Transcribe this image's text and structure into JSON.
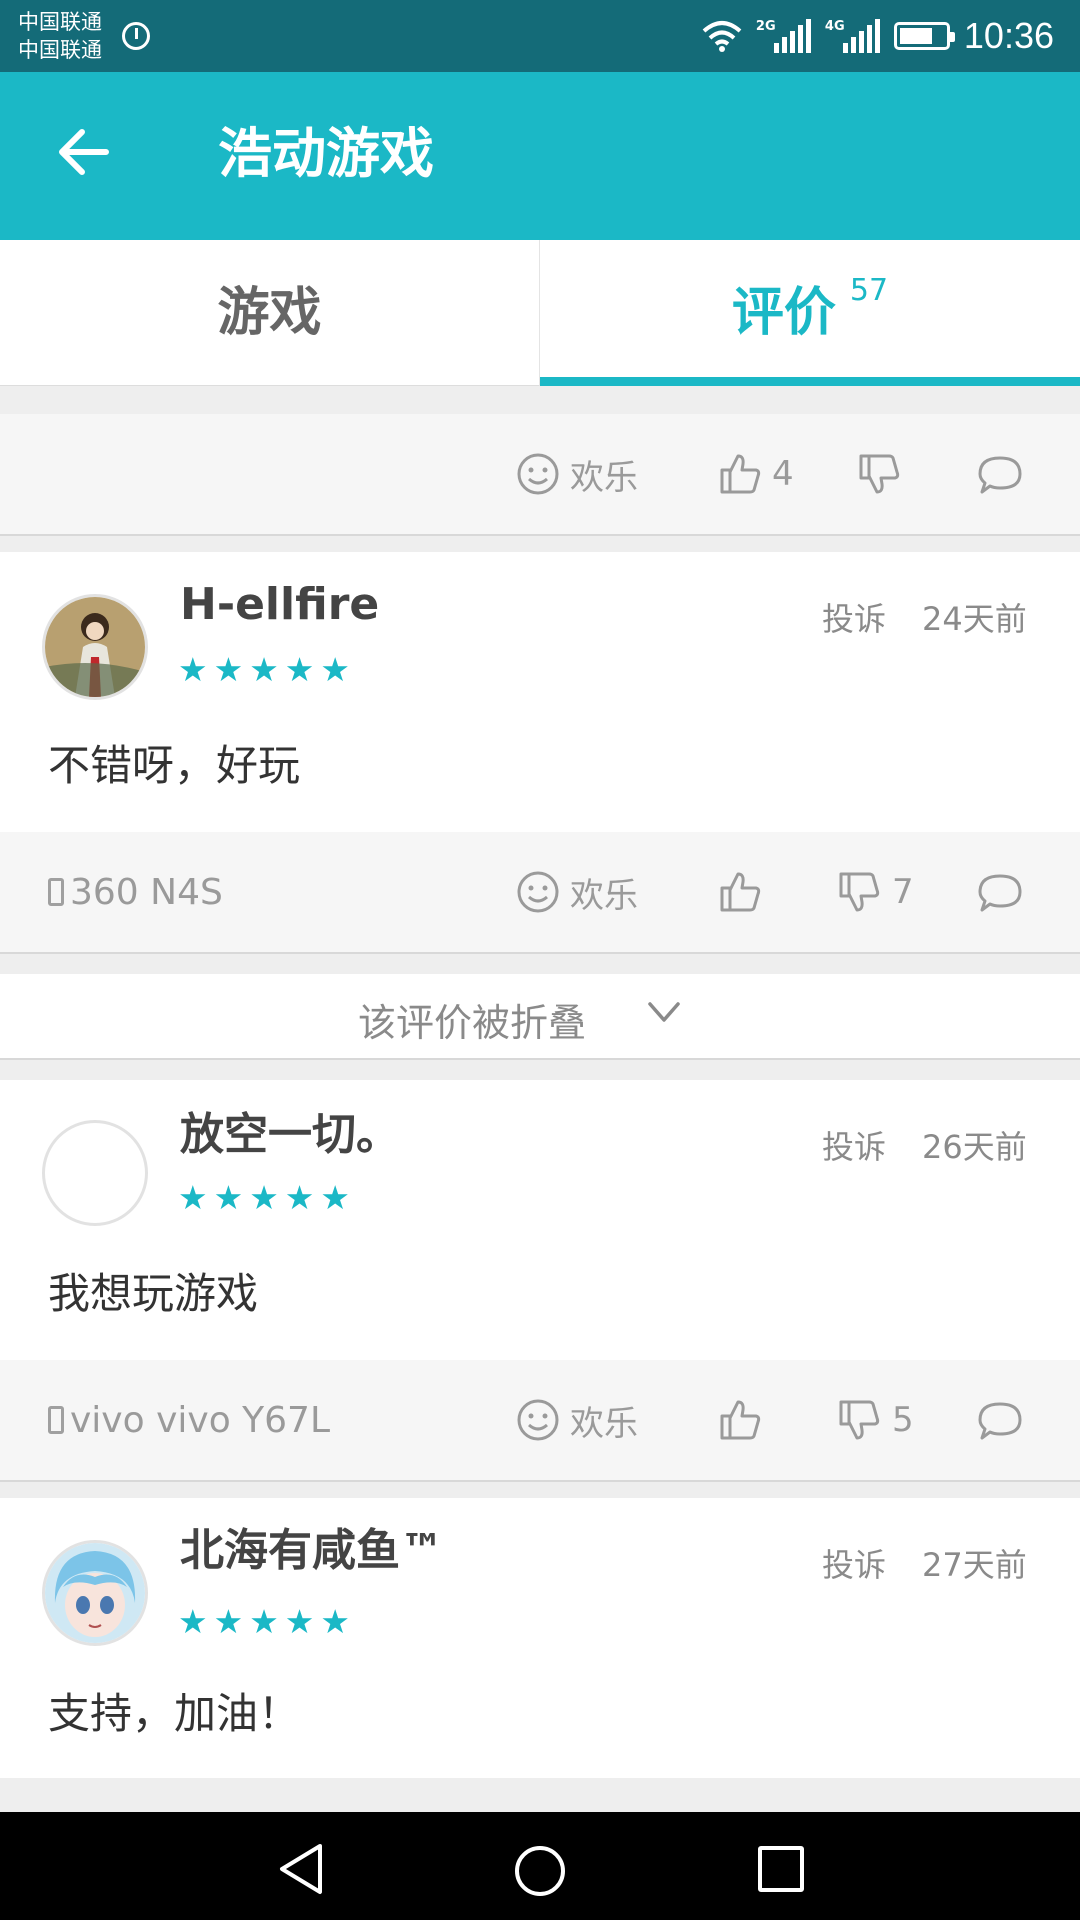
{
  "status_bar": {
    "carrier_1": "中国联通",
    "carrier_2": "中国联通",
    "network_1": "2G",
    "network_2": "4G",
    "time": "10:36"
  },
  "header": {
    "title": "浩动游戏"
  },
  "tabs": [
    {
      "label": "游戏"
    },
    {
      "label": "评价",
      "badge": "57"
    }
  ],
  "partial_review": {
    "mood": "欢乐",
    "likes": "4"
  },
  "reviews": [
    {
      "username": "H-ellfire",
      "rating": 5,
      "report": "投诉",
      "time": "24天前",
      "content": "不错呀，好玩",
      "device": "360 N4S",
      "mood": "欢乐",
      "dislikes": "7"
    },
    {
      "username": "放空一切。",
      "rating": 5,
      "report": "投诉",
      "time": "26天前",
      "content": "我想玩游戏",
      "device": "vivo vivo Y67L",
      "mood": "欢乐",
      "dislikes": "5"
    },
    {
      "username": "北海有咸鱼™",
      "rating": 5,
      "report": "投诉",
      "time": "27天前",
      "content": "支持，加油！"
    }
  ],
  "folded_notice": "该评价被折叠",
  "colors": {
    "accent": "#1bb8c6",
    "status_bar": "#146b78"
  }
}
